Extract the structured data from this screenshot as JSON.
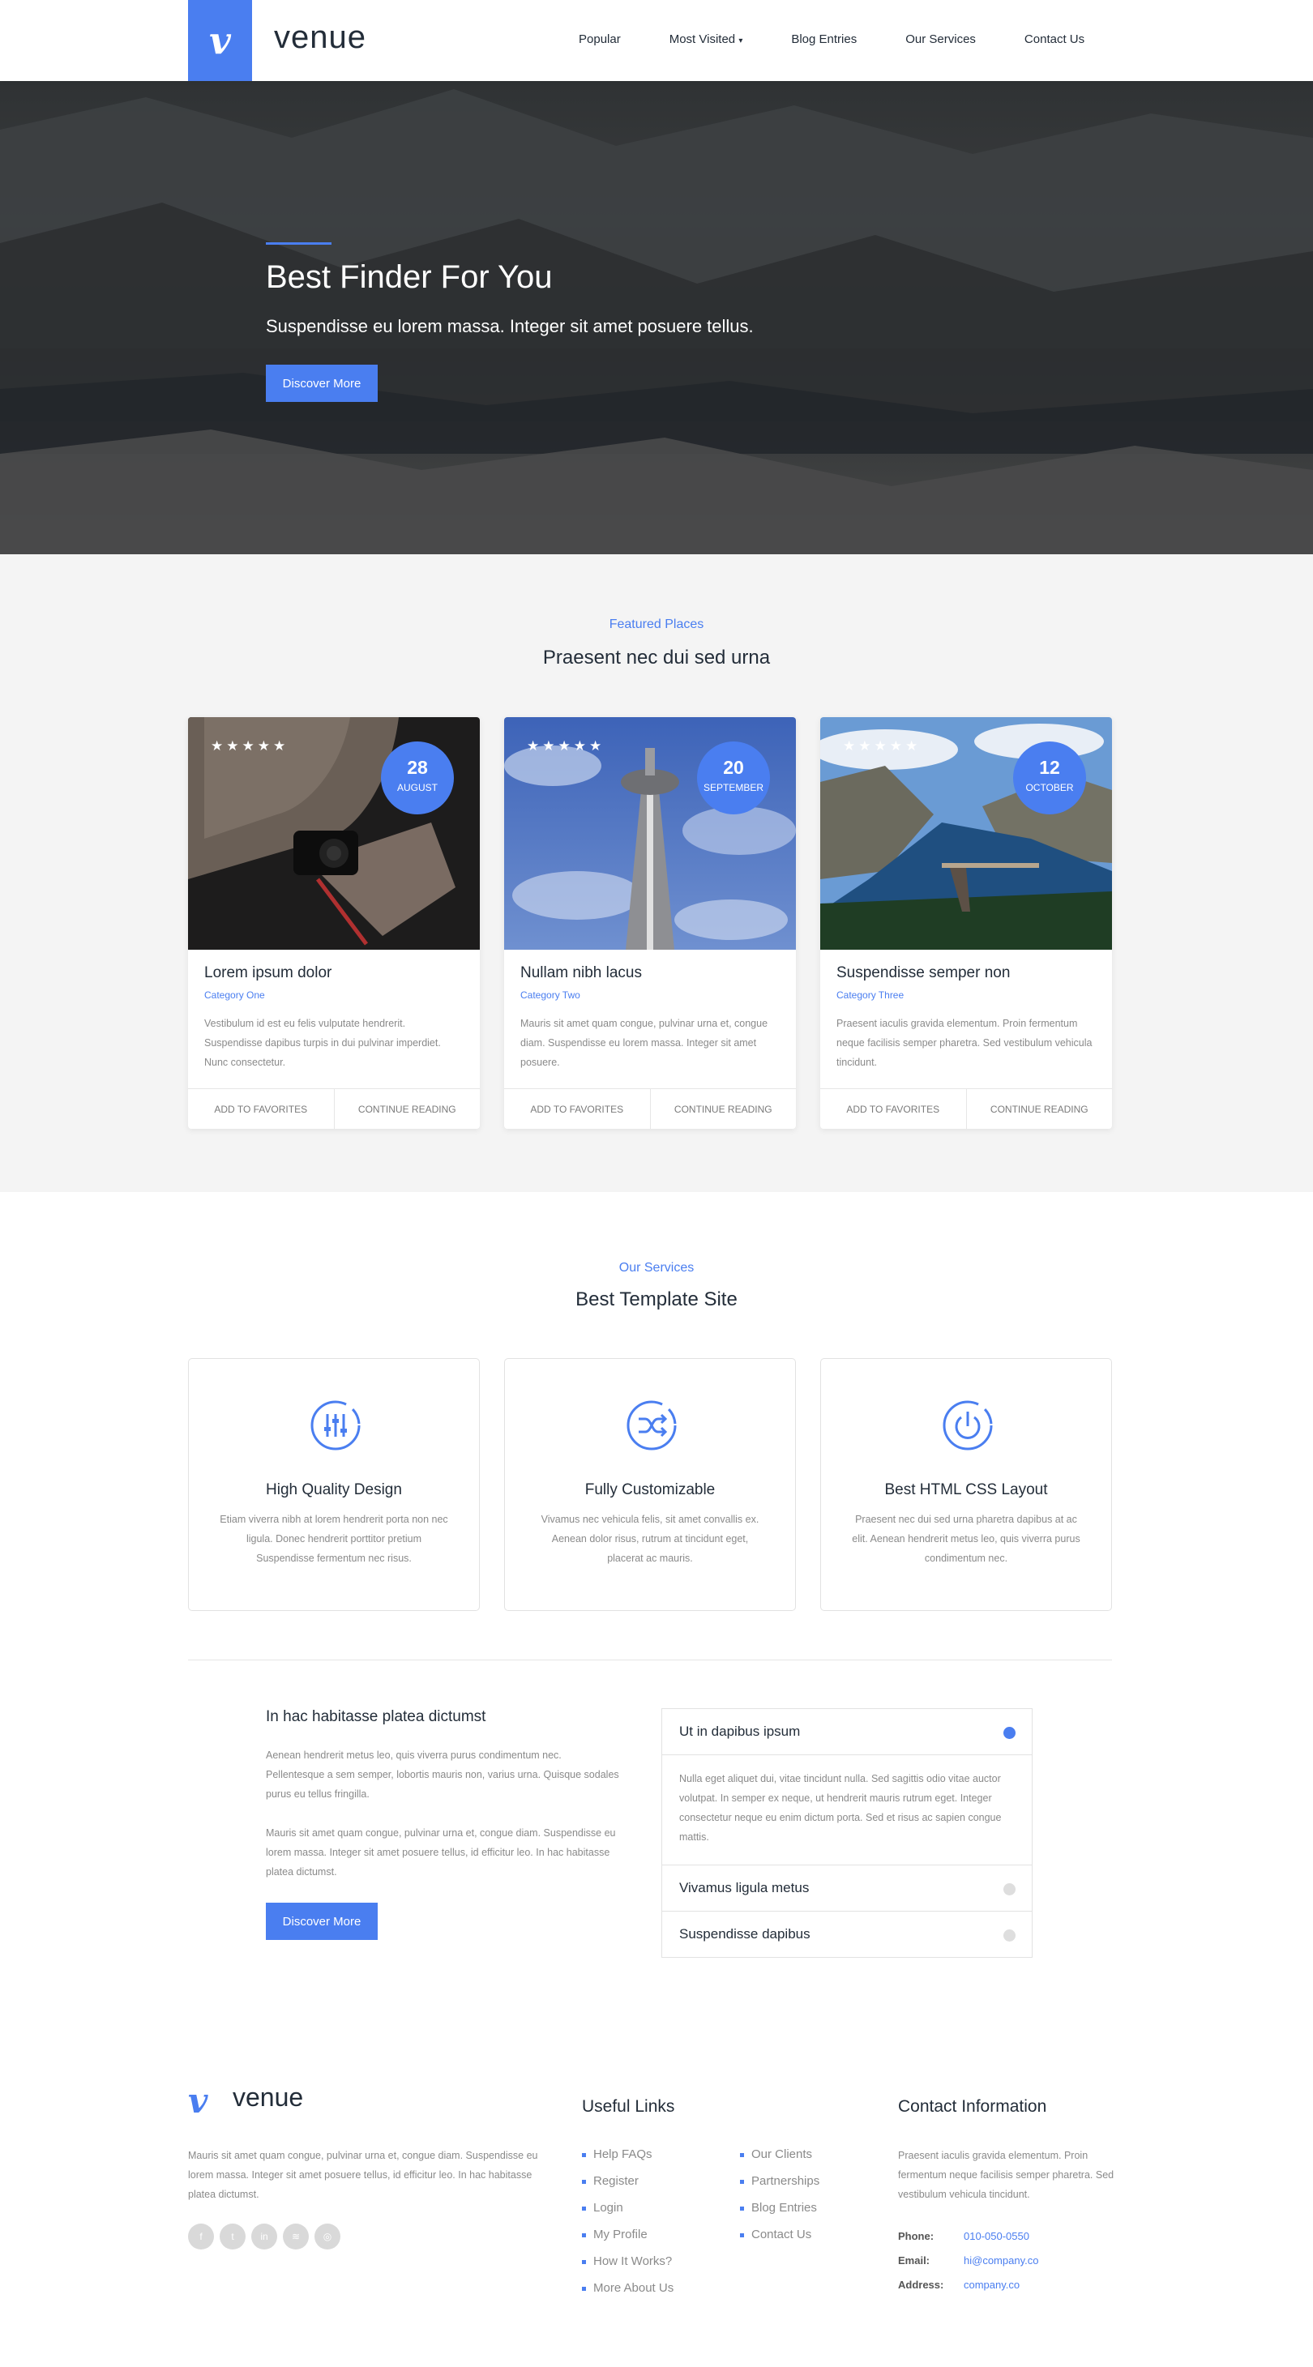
{
  "brand": {
    "logo_letter": "v",
    "name": "venue"
  },
  "nav": {
    "items": [
      "Popular",
      "Most Visited",
      "Blog Entries",
      "Our Services",
      "Contact Us"
    ],
    "caret": "▾"
  },
  "hero": {
    "title": "Best Finder For You",
    "subtitle": "Suspendisse eu lorem massa. Integer sit amet posuere tellus.",
    "button": "Discover More"
  },
  "featured": {
    "kicker": "Featured Places",
    "title": "Praesent nec dui sed urna",
    "cards": [
      {
        "stars": "★★★★★",
        "day": "28",
        "month": "August",
        "title": "Lorem ipsum dolor",
        "category": "Category One",
        "text": "Vestibulum id est eu felis vulputate hendrerit. Suspendisse dapibus turpis in dui pulvinar imperdiet. Nunc consectetur.",
        "fav": "Add to favorites",
        "read": "Continue Reading"
      },
      {
        "stars": "★★★★★",
        "day": "20",
        "month": "September",
        "title": "Nullam nibh lacus",
        "category": "Category Two",
        "text": "Mauris sit amet quam congue, pulvinar urna et, congue diam. Suspendisse eu lorem massa. Integer sit amet posuere.",
        "fav": "Add to favorites",
        "read": "Continue Reading"
      },
      {
        "stars": "★★★★★",
        "day": "12",
        "month": "October",
        "title": "Suspendisse semper non",
        "category": "Category Three",
        "text": "Praesent iaculis gravida elementum. Proin fermentum neque facilisis semper pharetra. Sed vestibulum vehicula tincidunt.",
        "fav": "Add to favorites",
        "read": "Continue Reading"
      }
    ]
  },
  "services": {
    "kicker": "Our Services",
    "title": "Best Template Site",
    "items": [
      {
        "icon": "sliders-icon",
        "title": "High Quality Design",
        "text": "Etiam viverra nibh at lorem hendrerit porta non nec ligula. Donec hendrerit porttitor pretium Suspendisse fermentum nec risus."
      },
      {
        "icon": "shuffle-icon",
        "title": "Fully Customizable",
        "text": "Vivamus nec vehicula felis, sit amet convallis ex. Aenean dolor risus, rutrum at tincidunt eget, placerat ac mauris."
      },
      {
        "icon": "power-icon",
        "title": "Best HTML CSS Layout",
        "text": "Praesent nec dui sed urna pharetra dapibus at ac elit. Aenean hendrerit metus leo, quis viverra purus condimentum nec."
      }
    ]
  },
  "about": {
    "title": "In hac habitasse platea dictumst",
    "p1": "Aenean hendrerit metus leo, quis viverra purus condimentum nec. Pellentesque a sem semper, lobortis mauris non, varius urna. Quisque sodales purus eu tellus fringilla.",
    "p2": "Mauris sit amet quam congue, pulvinar urna et, congue diam. Suspendisse eu lorem massa. Integer sit amet posuere tellus, id efficitur leo. In hac habitasse platea dictumst.",
    "button": "Discover More"
  },
  "accordion": [
    {
      "title": "Ut in dapibus ipsum",
      "open": true,
      "body": "Nulla eget aliquet dui, vitae tincidunt nulla. Sed sagittis odio vitae auctor volutpat. In semper ex neque, ut hendrerit mauris rutrum eget. Integer consectetur neque eu enim dictum porta. Sed et risus ac sapien congue mattis."
    },
    {
      "title": "Vivamus ligula metus",
      "open": false
    },
    {
      "title": "Suspendisse dapibus",
      "open": false
    }
  ],
  "footer": {
    "about": "Mauris sit amet quam congue, pulvinar urna et, congue diam. Suspendisse eu lorem massa. Integer sit amet posuere tellus, id efficitur leo. In hac habitasse platea dictumst.",
    "socials": [
      "facebook-icon",
      "twitter-icon",
      "linkedin-icon",
      "rss-icon",
      "dribbble-icon"
    ],
    "useful_title": "Useful Links",
    "links_col1": [
      "Help FAQs",
      "Register",
      "Login",
      "My Profile",
      "How It Works?",
      "More About Us"
    ],
    "links_col2": [
      "Our Clients",
      "Partnerships",
      "Blog Entries",
      "Contact Us"
    ],
    "contact_title": "Contact Information",
    "contact_text": "Praesent iaculis gravida elementum. Proin fermentum neque facilisis semper pharetra. Sed vestibulum vehicula tincidunt.",
    "phone_label": "Phone:",
    "phone": "010-050-0550",
    "email_label": "Email:",
    "email": "hi@company.co",
    "address_label": "Address:",
    "address": "company.co"
  },
  "colors": {
    "accent": "#4a7ef0",
    "text": "#232d39",
    "muted": "#8a8a8a",
    "section_bg": "#f4f4f4"
  }
}
